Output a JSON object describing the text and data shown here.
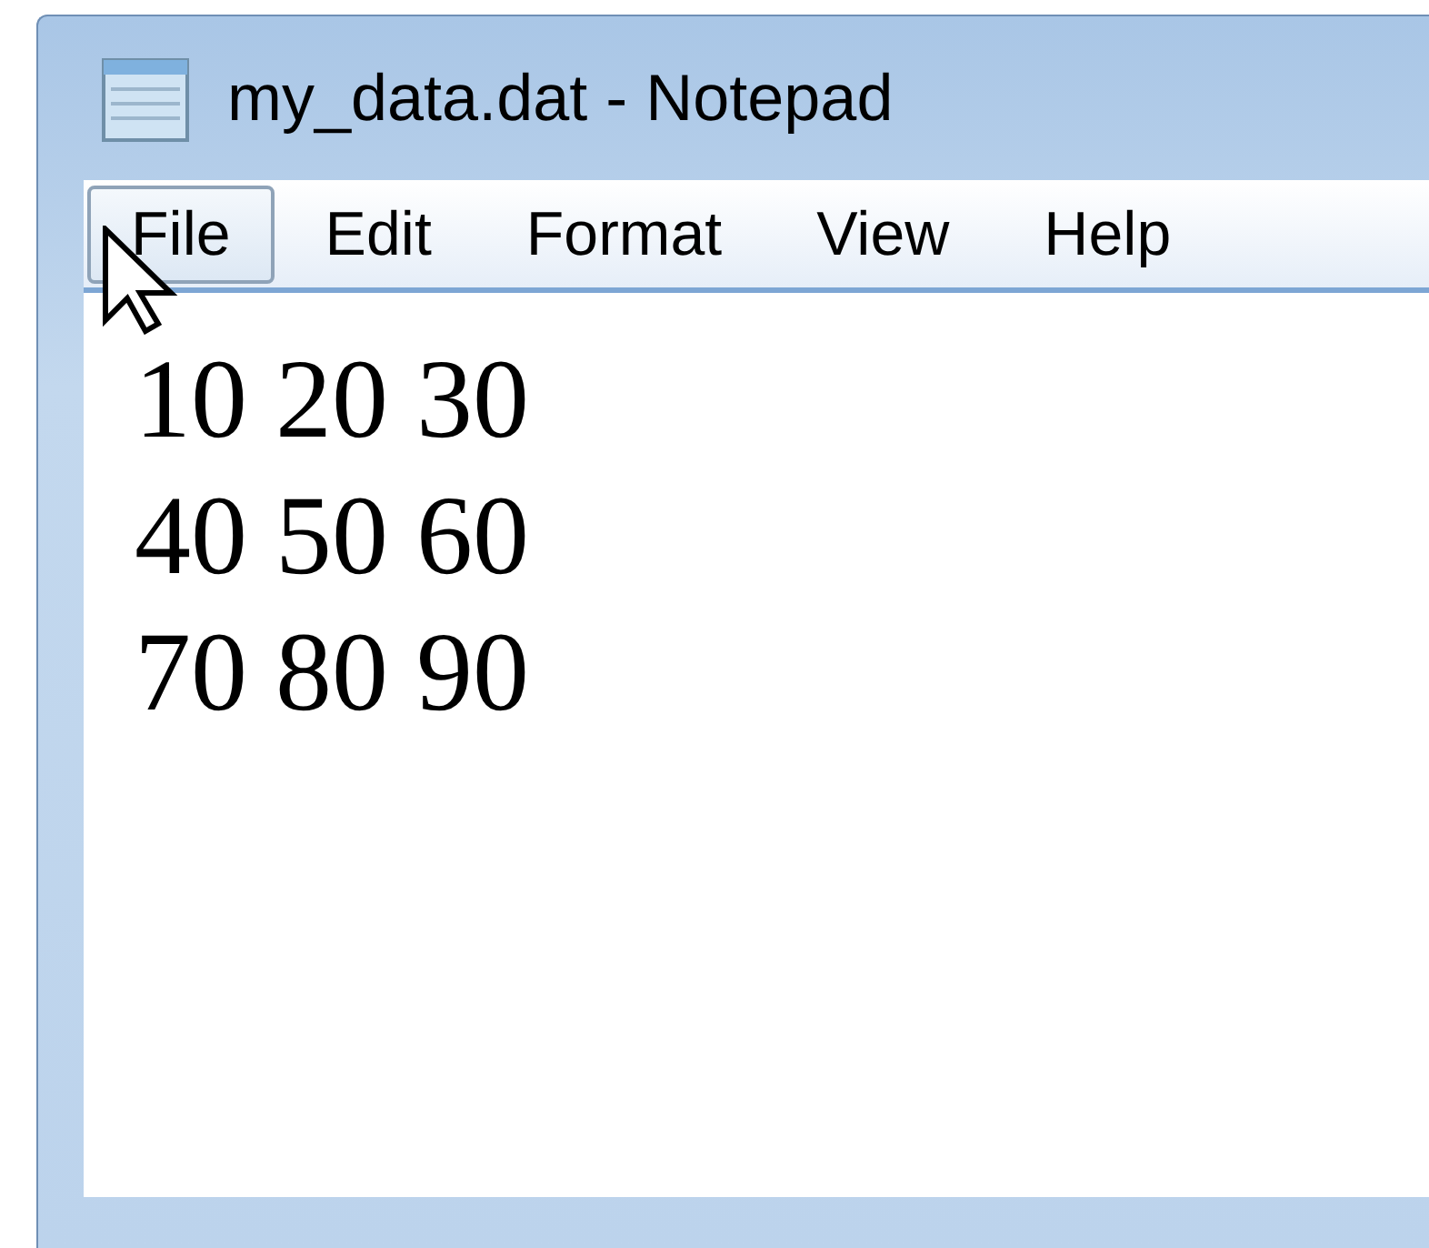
{
  "window": {
    "title": "my_data.dat - Notepad"
  },
  "menu": [
    {
      "label": "File",
      "selected": true
    },
    {
      "label": "Edit",
      "selected": false
    },
    {
      "label": "Format",
      "selected": false
    },
    {
      "label": "View",
      "selected": false
    },
    {
      "label": "Help",
      "selected": false
    }
  ],
  "document": {
    "lines": [
      "10 20 30",
      "40 50 60",
      "70 80 90"
    ]
  }
}
